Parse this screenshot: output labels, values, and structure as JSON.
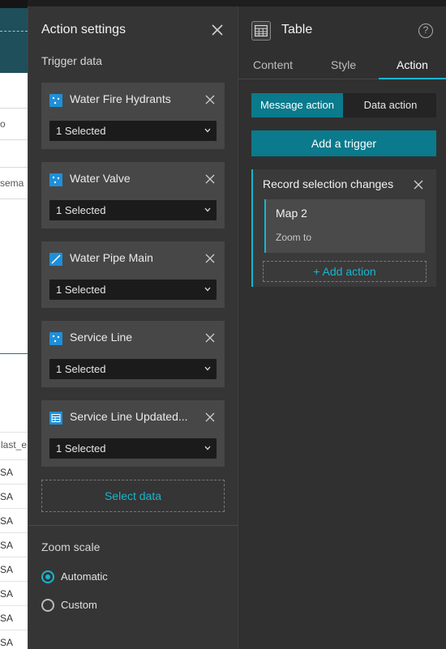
{
  "background_app": {
    "field1": "o",
    "field2": "sema",
    "column_header": "last_e",
    "cells": [
      "SA",
      "SA",
      "SA",
      "SA",
      "SA",
      "SA",
      "SA",
      "SA"
    ]
  },
  "action_settings": {
    "title": "Action settings",
    "trigger_data_label": "Trigger data",
    "data_sources": [
      {
        "name": "Water Fire Hydrants",
        "icon": "point-layer-icon",
        "selection": "1 Selected"
      },
      {
        "name": "Water Valve",
        "icon": "point-layer-icon",
        "selection": "1 Selected"
      },
      {
        "name": "Water Pipe Main",
        "icon": "line-layer-icon",
        "selection": "1 Selected"
      },
      {
        "name": "Service Line",
        "icon": "point-layer-icon",
        "selection": "1 Selected"
      },
      {
        "name": "Service Line Updated...",
        "icon": "table-layer-icon",
        "selection": "1 Selected"
      }
    ],
    "select_data_label": "Select data",
    "zoom_scale_label": "Zoom scale",
    "zoom_options": [
      {
        "label": "Automatic",
        "selected": true
      },
      {
        "label": "Custom",
        "selected": false
      }
    ]
  },
  "widget_panel": {
    "title": "Table",
    "help": "?",
    "tabs": [
      "Content",
      "Style",
      "Action"
    ],
    "active_tab": "Action",
    "action_types": [
      "Message action",
      "Data action"
    ],
    "active_action_type": "Message action",
    "add_trigger_label": "Add a trigger",
    "trigger": {
      "title": "Record selection changes",
      "action": {
        "target": "Map 2",
        "type": "Zoom to"
      },
      "add_action_label": "+ Add action"
    }
  },
  "colors": {
    "accent": "#17b6d0",
    "primary_button": "#0a7a8c",
    "layer_icon": "#1f8fd8",
    "panel_bg": "#353535"
  }
}
